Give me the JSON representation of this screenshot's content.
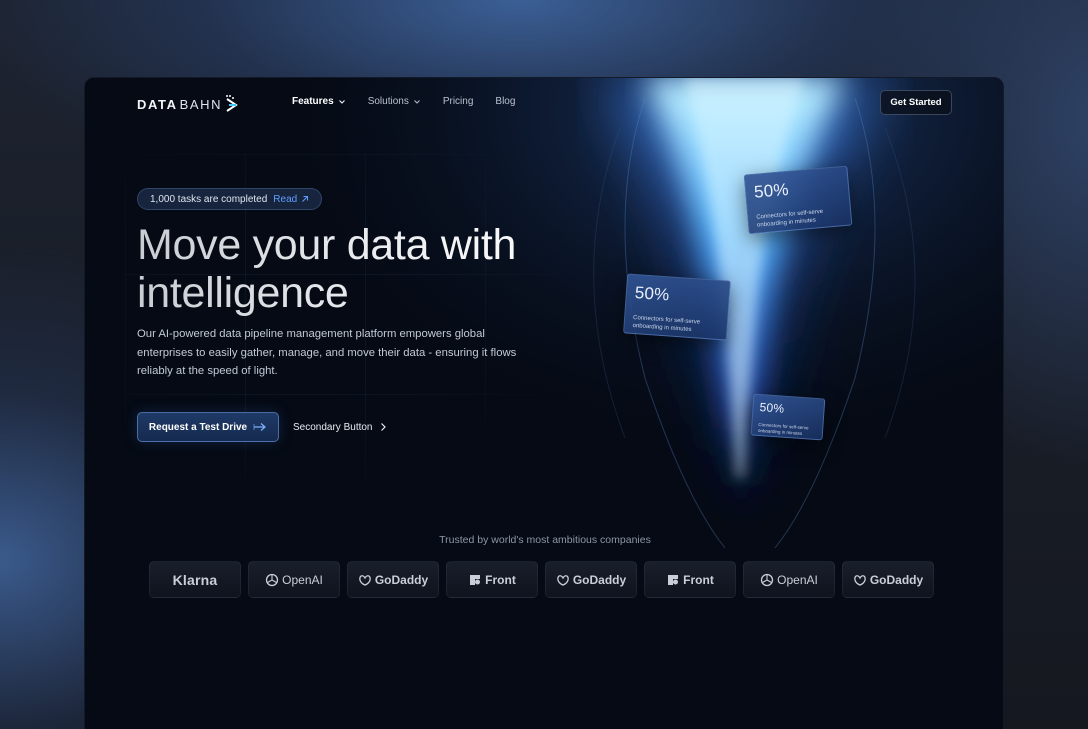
{
  "brand": {
    "logo_bold": "DATA",
    "logo_thin": "BAHN"
  },
  "nav": {
    "items": [
      {
        "label": "Features"
      },
      {
        "label": "Solutions"
      },
      {
        "label": "Pricing"
      },
      {
        "label": "Blog"
      }
    ],
    "cta": "Get Started"
  },
  "hero": {
    "pill_text": "1,000 tasks are completed",
    "pill_link": "Read",
    "headline": "Move your data with intelligence",
    "subtext": "Our AI-powered data pipeline management platform empowers global enterprises to easily gather, manage, and move their data - ensuring it flows reliably at the speed of light.",
    "primary_button": "Request a Test Drive",
    "secondary_button": "Secondary Button"
  },
  "stats": [
    {
      "value": "50%",
      "caption": "Connectors for self-serve onboarding in minutes"
    },
    {
      "value": "50%",
      "caption": "Connectors for self-serve onboarding in minutes"
    },
    {
      "value": "50%",
      "caption": "Connectors for self-serve onboarding in minutes"
    }
  ],
  "trusted": {
    "label": "Trusted by world's most ambitious companies",
    "logos": [
      {
        "name": "Klarna",
        "icon": "none"
      },
      {
        "name": "OpenAI",
        "icon": "openai-icon"
      },
      {
        "name": "GoDaddy",
        "icon": "godaddy-icon"
      },
      {
        "name": "Front",
        "icon": "front-icon"
      },
      {
        "name": "GoDaddy",
        "icon": "godaddy-icon"
      },
      {
        "name": "Front",
        "icon": "front-icon"
      },
      {
        "name": "OpenAI",
        "icon": "openai-icon"
      },
      {
        "name": "GoDaddy",
        "icon": "godaddy-icon"
      }
    ]
  },
  "colors": {
    "accent": "#5f9dff",
    "beam": "#7fd3ff",
    "card": "#2a4f8f",
    "frame_bg": "#050a14"
  }
}
